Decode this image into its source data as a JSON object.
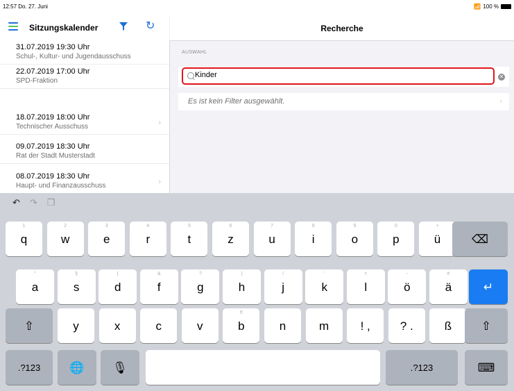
{
  "status": {
    "time": "12:57",
    "date": "Do. 27. Juni",
    "battery": "100 %"
  },
  "nav": {
    "title": "Sitzungskalender",
    "right_title": "Recherche"
  },
  "sessions": [
    {
      "date": "31.07.2019 19:30 Uhr",
      "name": "Schul-, Kultur- und Jugendausschuss"
    },
    {
      "date": "22.07.2019 17:00 Uhr",
      "name": "SPD-Fraktion"
    },
    {
      "date": "18.07.2019 18:00 Uhr",
      "name": "Technischer Ausschuss"
    },
    {
      "date": "09.07.2019 18:30 Uhr",
      "name": "Rat der Stadt Musterstadt"
    },
    {
      "date": "08.07.2019 18:30 Uhr",
      "name": "Haupt- und Finanzausschuss"
    }
  ],
  "recherche": {
    "section_label": "AUSWAHL",
    "search_value": "Kinder",
    "no_filter": "Es ist kein Filter ausgewählt."
  },
  "keyboard": {
    "row1": [
      {
        "k": "q",
        "h": "1"
      },
      {
        "k": "w",
        "h": "2"
      },
      {
        "k": "e",
        "h": "3"
      },
      {
        "k": "r",
        "h": "4"
      },
      {
        "k": "t",
        "h": "5"
      },
      {
        "k": "z",
        "h": "6"
      },
      {
        "k": "u",
        "h": "7"
      },
      {
        "k": "i",
        "h": "8"
      },
      {
        "k": "o",
        "h": "9"
      },
      {
        "k": "p",
        "h": "0"
      },
      {
        "k": "ü",
        "h": "+"
      }
    ],
    "row2": [
      {
        "k": "a",
        "h": "\""
      },
      {
        "k": "s",
        "h": "§"
      },
      {
        "k": "d",
        "h": "("
      },
      {
        "k": "f",
        "h": "&"
      },
      {
        "k": "g",
        "h": "?"
      },
      {
        "k": "h",
        "h": ")"
      },
      {
        "k": "j",
        "h": "/"
      },
      {
        "k": "k",
        "h": "'"
      },
      {
        "k": "l",
        "h": "="
      },
      {
        "k": "ö",
        "h": "-"
      },
      {
        "k": "ä",
        "h": "#"
      }
    ],
    "row3": [
      {
        "k": "y",
        "h": ""
      },
      {
        "k": "x",
        "h": ""
      },
      {
        "k": "c",
        "h": ""
      },
      {
        "k": "v",
        "h": ""
      },
      {
        "k": "b",
        "h": "€"
      },
      {
        "k": "n",
        "h": ""
      },
      {
        "k": "m",
        "h": ""
      },
      {
        "k": "!\n,",
        "h": ""
      },
      {
        "k": "?\n.",
        "h": ""
      },
      {
        "k": "ß",
        "h": ""
      }
    ],
    "numbers_label": ".?123",
    "colors": {
      "return": "#1a7cf2",
      "highlight": "#e0141e"
    }
  }
}
